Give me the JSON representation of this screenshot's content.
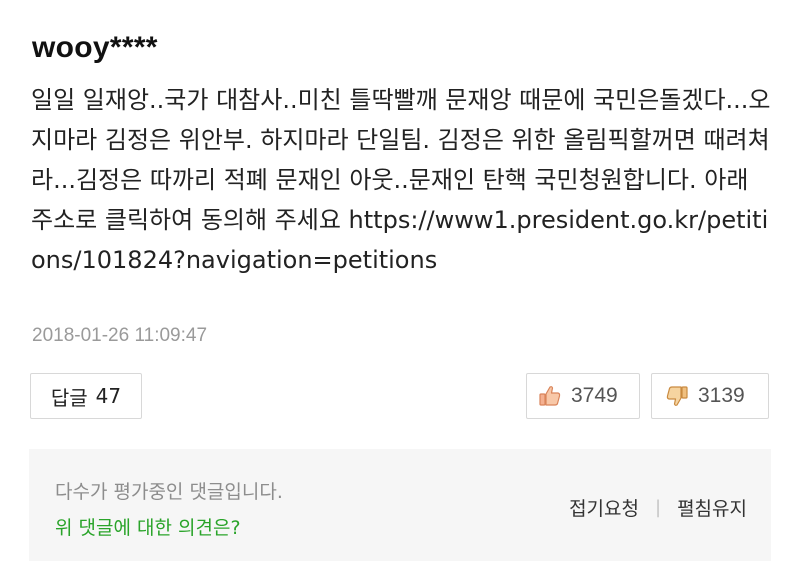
{
  "comment": {
    "author": "wooy****",
    "text": "일일 일재앙..국가 대참사..미친 틀딱빨깨 문재앙 때문에 국민은돌겠다...오지마라 김정은 위안부. 하지마라 단일팀. 김정은 위한 올림픽할꺼면 때려쳐라...김정은 따까리 적폐 문재인 아웃..문재인 탄핵 국민청원합니다. 아래 주소로 클릭하여 동의해 주세요 https://www1.president.go.kr/petitions/101824?navigation=petitions",
    "timestamp": "2018-01-26 11:09:47"
  },
  "actions": {
    "reply_label": "답글",
    "reply_count": "47",
    "like_count": "3749",
    "dislike_count": "3139",
    "like_icon": "thumbs-up-icon",
    "dislike_icon": "thumbs-down-icon",
    "like_icon_color": "#f0a070",
    "dislike_icon_color": "#e0a060"
  },
  "panel": {
    "notice": "다수가 평가중인 댓글입니다.",
    "question": "위 댓글에 대한 의견은?",
    "fold_request": "접기요청",
    "separator": "|",
    "keep_expanded": "펼침유지",
    "question_color": "#2aa42a"
  }
}
